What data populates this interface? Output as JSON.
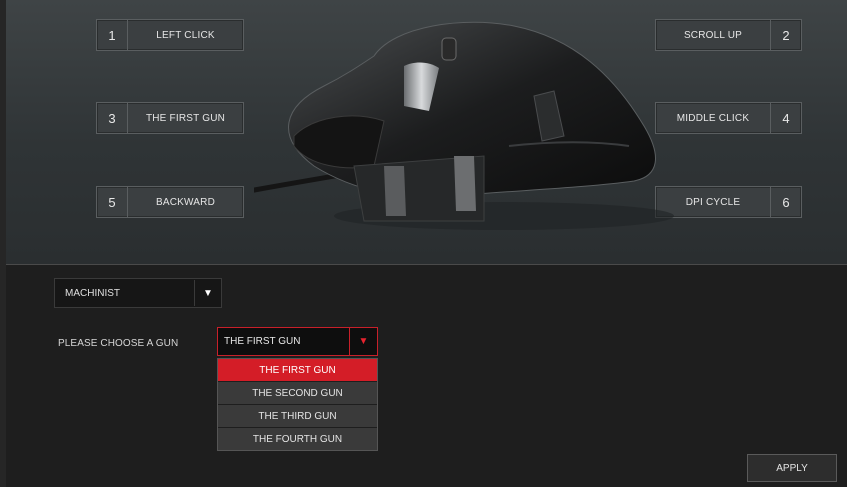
{
  "mappings": {
    "left": [
      {
        "num": "1",
        "label": "LEFT CLICK"
      },
      {
        "num": "3",
        "label": "THE FIRST GUN"
      },
      {
        "num": "5",
        "label": "BACKWARD"
      }
    ],
    "right": [
      {
        "num": "2",
        "label": "SCROLL UP"
      },
      {
        "num": "4",
        "label": "MIDDLE CLICK"
      },
      {
        "num": "6",
        "label": "DPI CYCLE"
      }
    ]
  },
  "profile": {
    "selected": "MACHINIST",
    "arrow": "▼"
  },
  "gun": {
    "label": "PLEASE CHOOSE A GUN",
    "selected": "THE FIRST GUN",
    "arrow": "▼",
    "options": [
      "THE FIRST GUN",
      "THE SECOND GUN",
      "THE THIRD GUN",
      "THE FOURTH GUN"
    ]
  },
  "apply_label": "APPLY",
  "colors": {
    "accent": "#d41d27",
    "panel": "#1e1e1e"
  },
  "icons": {
    "dropdown": "chevron-down-icon",
    "mouse": "mouse-image"
  }
}
